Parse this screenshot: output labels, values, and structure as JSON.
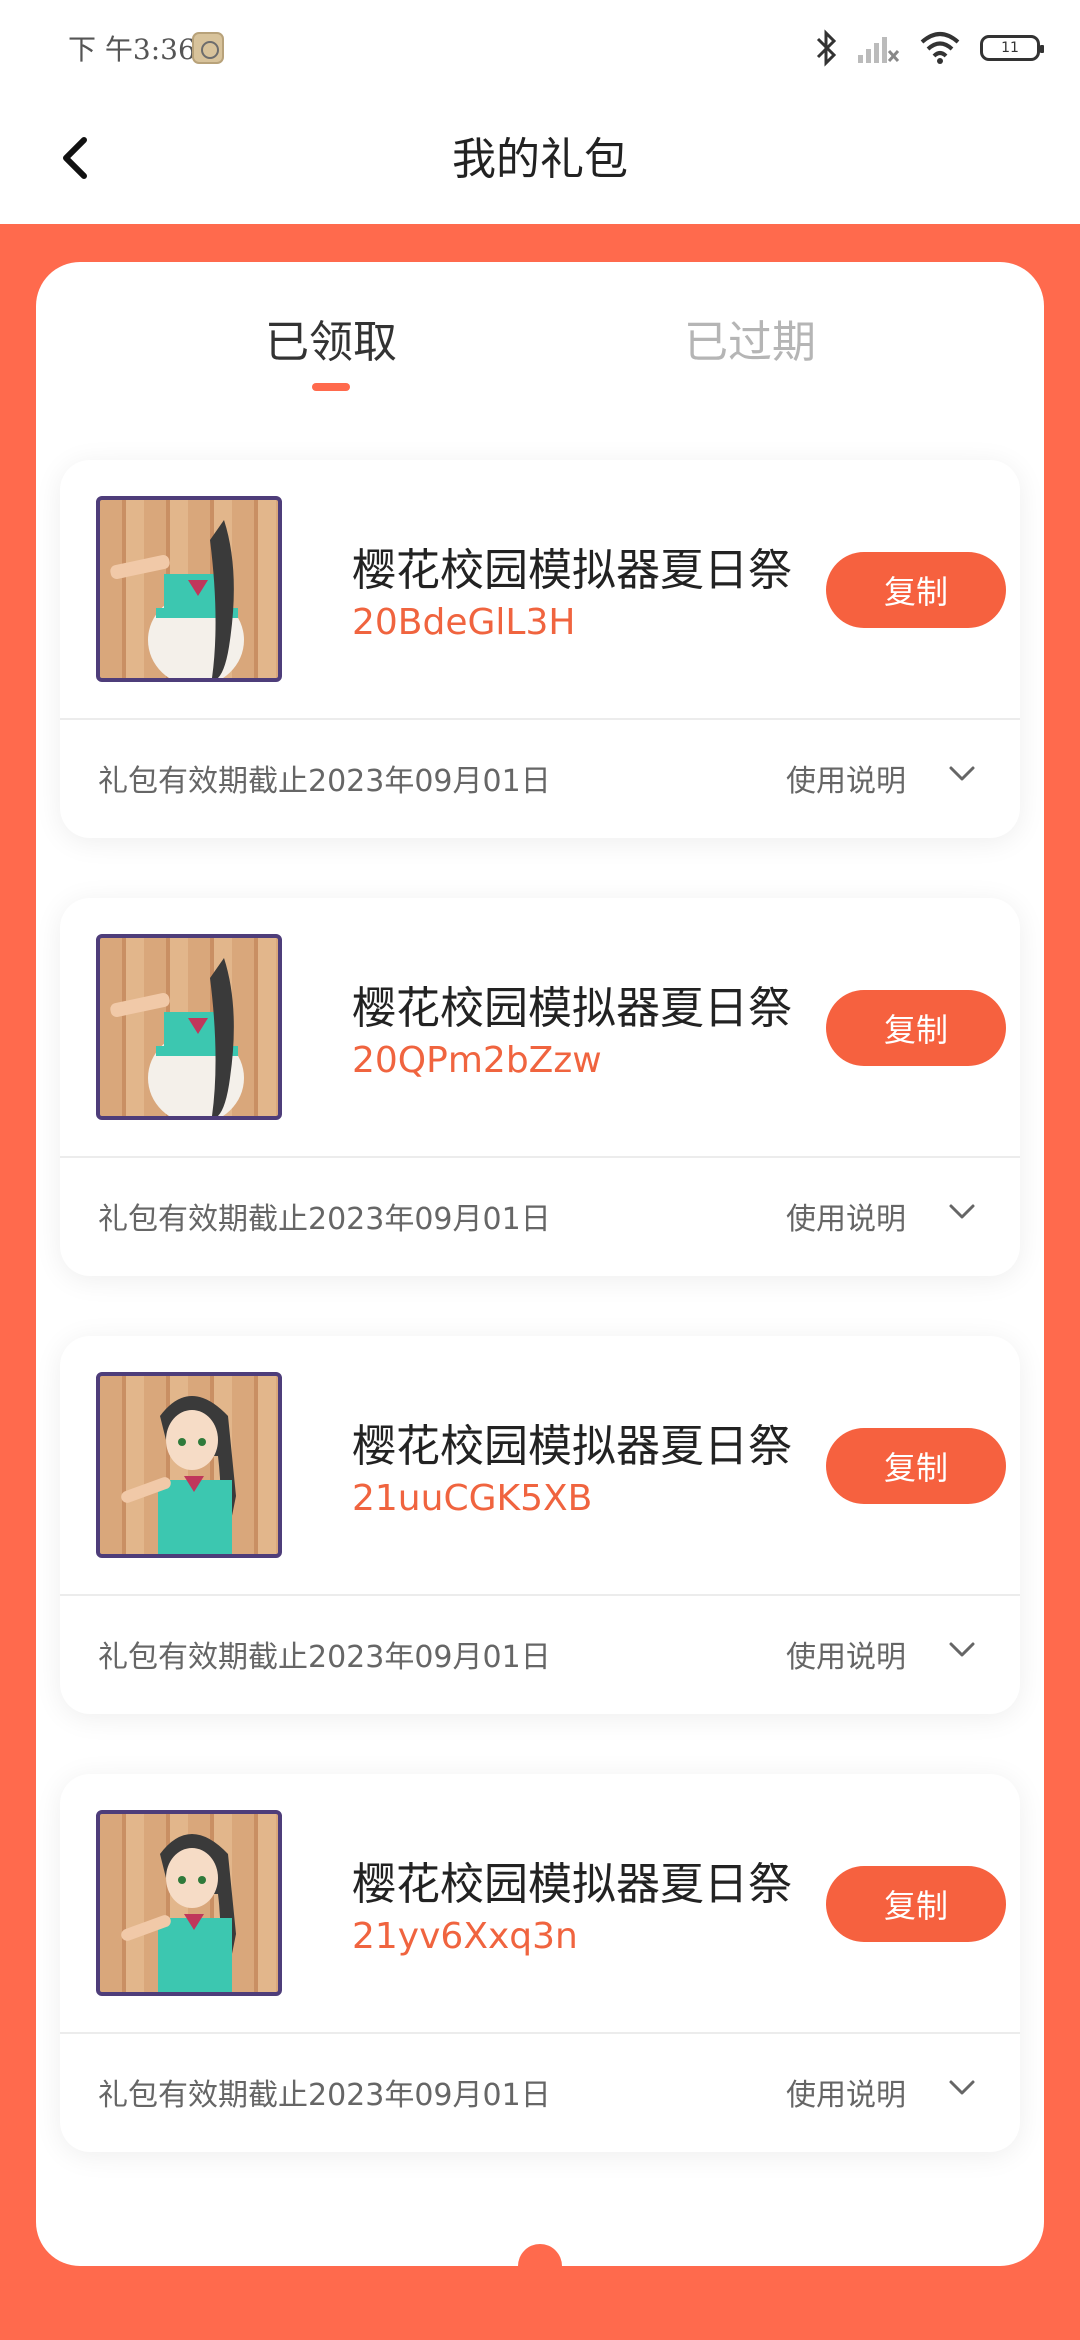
{
  "status_bar": {
    "time": "下 午3:36",
    "battery": "11"
  },
  "header": {
    "title": "我的礼包"
  },
  "tabs": [
    {
      "label": "已领取",
      "active": true
    },
    {
      "label": "已过期",
      "active": false
    }
  ],
  "gifts": [
    {
      "name": "樱花校园模拟器夏日祭",
      "code": "20BdeGlL3H",
      "copy_label": "复制",
      "expiry": "礼包有效期截止2023年09月01日",
      "usage_label": "使用说明"
    },
    {
      "name": "樱花校园模拟器夏日祭",
      "code": "20QPm2bZzw",
      "copy_label": "复制",
      "expiry": "礼包有效期截止2023年09月01日",
      "usage_label": "使用说明"
    },
    {
      "name": "樱花校园模拟器夏日祭",
      "code": "21uuCGK5XB",
      "copy_label": "复制",
      "expiry": "礼包有效期截止2023年09月01日",
      "usage_label": "使用说明"
    },
    {
      "name": "樱花校园模拟器夏日祭",
      "code": "21yv6Xxq3n",
      "copy_label": "复制",
      "expiry": "礼包有效期截止2023年09月01日",
      "usage_label": "使用说明"
    }
  ],
  "colors": {
    "accent": "#f6613f",
    "background": "#ff6a4d"
  }
}
